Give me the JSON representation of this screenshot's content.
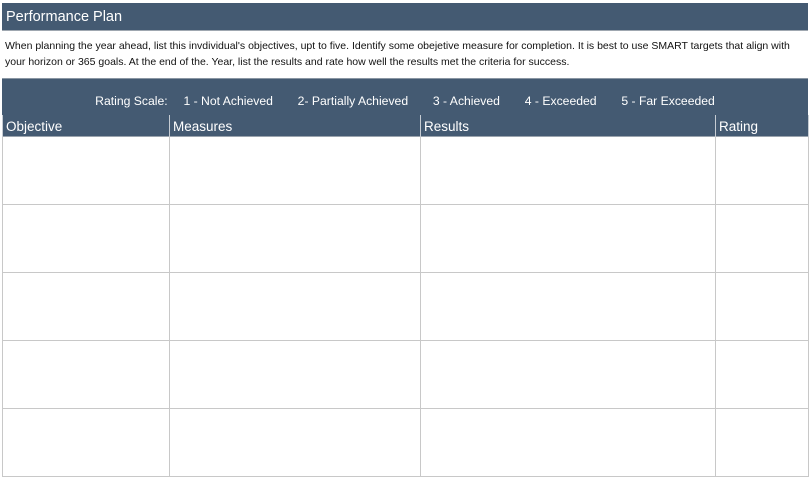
{
  "title": "Performance Plan",
  "instructions": "When planning the year ahead, list this invdividual's objectives, upt to five. Identify some obejetive measure for completion. It is best to use SMART targets that align with your horizon or 365 goals. At the end of the. Year, list the results and rate how well the results met the criteria for success.",
  "rating_scale": {
    "label": "Rating Scale:",
    "levels": [
      "1 - Not Achieved",
      "2- Partially Achieved",
      "3 - Achieved",
      "4 - Exceeded",
      "5 - Far Exceeded"
    ]
  },
  "table": {
    "columns": [
      "Objective",
      "Measures",
      "Results",
      "Rating"
    ],
    "rows": [
      [
        "",
        "",
        "",
        ""
      ],
      [
        "",
        "",
        "",
        ""
      ],
      [
        "",
        "",
        "",
        ""
      ],
      [
        "",
        "",
        "",
        ""
      ],
      [
        "",
        "",
        "",
        ""
      ]
    ]
  },
  "colors": {
    "header_fill": "#445a72",
    "header_text": "#ffffff",
    "grid_line": "#c8c8c8"
  }
}
